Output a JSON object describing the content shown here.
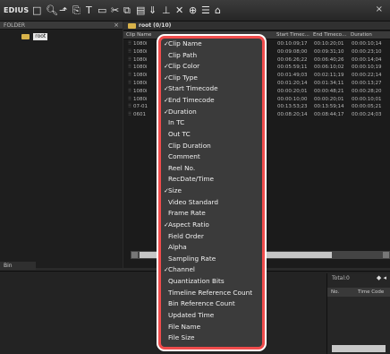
{
  "toolbar": {
    "brand": "EDIUS",
    "icons": [
      "folder-up-icon",
      "search-icon",
      "up-arrow-icon",
      "import-icon",
      "title-icon",
      "monitor-icon",
      "cut-icon",
      "copy-icon",
      "paste-icon",
      "add-to-timeline-icon",
      "insert-icon",
      "delete-icon",
      "properties-icon",
      "view-icon",
      "folder-icon"
    ],
    "close": "×"
  },
  "folder_panel": {
    "header": "FOLDER",
    "close": "×",
    "root_label": "root"
  },
  "clip_panel": {
    "path": "root (0/10)",
    "columns": [
      "Clip Name",
      "Start Timec...",
      "End Timeco...",
      "Duration"
    ],
    "rows": [
      {
        "name": "1080i",
        "start": "00:10:09;17",
        "end": "00:10:20;01",
        "dur": "00:00:10;14"
      },
      {
        "name": "1080i",
        "start": "00:09:08;00",
        "end": "00:09:31;10",
        "dur": "00:00:23;10"
      },
      {
        "name": "1080i",
        "start": "00:06:26;22",
        "end": "00:06:40;26",
        "dur": "00:00:14;04"
      },
      {
        "name": "1080i",
        "start": "00:05:59;11",
        "end": "00:06:10;02",
        "dur": "00:00:10;19"
      },
      {
        "name": "1080i",
        "start": "00:01:49;03",
        "end": "00:02:11;19",
        "dur": "00:00:22;14"
      },
      {
        "name": "1080i",
        "start": "00:01:20;14",
        "end": "00:01:34;11",
        "dur": "00:00:13;27"
      },
      {
        "name": "1080i",
        "start": "00:00:20;01",
        "end": "00:00:48;21",
        "dur": "00:00:28;20"
      },
      {
        "name": "1080i",
        "start": "00:00:10;00",
        "end": "00:00:20;01",
        "dur": "00:00:10;01"
      },
      {
        "name": "07-01",
        "start": "00:13:53;23",
        "end": "00:13:59;14",
        "dur": "00:00:05;21"
      },
      {
        "name": "0601",
        "start": "00:08:20;14",
        "end": "00:08:44;17",
        "dur": "00:00:24;03"
      }
    ]
  },
  "bin_tab": "Bin",
  "marker_panel": {
    "total": "Total:0",
    "arrows": "◆ ◂",
    "col_no": "No.",
    "col_timecode": "Time Code"
  },
  "context_menu": {
    "items": [
      {
        "label": "Clip Name",
        "checked": true
      },
      {
        "label": "Clip Path",
        "checked": false
      },
      {
        "label": "Clip Color",
        "checked": true
      },
      {
        "label": "Clip Type",
        "checked": true
      },
      {
        "label": "Start Timecode",
        "checked": true
      },
      {
        "label": "End Timecode",
        "checked": true
      },
      {
        "label": "Duration",
        "checked": true
      },
      {
        "label": "In TC",
        "checked": false
      },
      {
        "label": "Out TC",
        "checked": false
      },
      {
        "label": "Clip Duration",
        "checked": false
      },
      {
        "label": "Comment",
        "checked": false
      },
      {
        "label": "Reel No.",
        "checked": false
      },
      {
        "label": "RecDate/Time",
        "checked": false
      },
      {
        "label": "Size",
        "checked": true
      },
      {
        "label": "Video Standard",
        "checked": false
      },
      {
        "label": "Frame Rate",
        "checked": false
      },
      {
        "label": "Aspect Ratio",
        "checked": true
      },
      {
        "label": "Field Order",
        "checked": false
      },
      {
        "label": "Alpha",
        "checked": false
      },
      {
        "label": "Sampling Rate",
        "checked": false
      },
      {
        "label": "Channel",
        "checked": true
      },
      {
        "label": "Quantization Bits",
        "checked": false
      },
      {
        "label": "Timeline Reference Count",
        "checked": false
      },
      {
        "label": "Bin Reference Count",
        "checked": false
      },
      {
        "label": "Updated Time",
        "checked": false
      },
      {
        "label": "File Name",
        "checked": false
      },
      {
        "label": "File Size",
        "checked": false
      }
    ]
  },
  "colors": {
    "highlight_border": "#f04c4c",
    "menu_bg": "#3b3b3b",
    "folder": "#d8b24a"
  }
}
